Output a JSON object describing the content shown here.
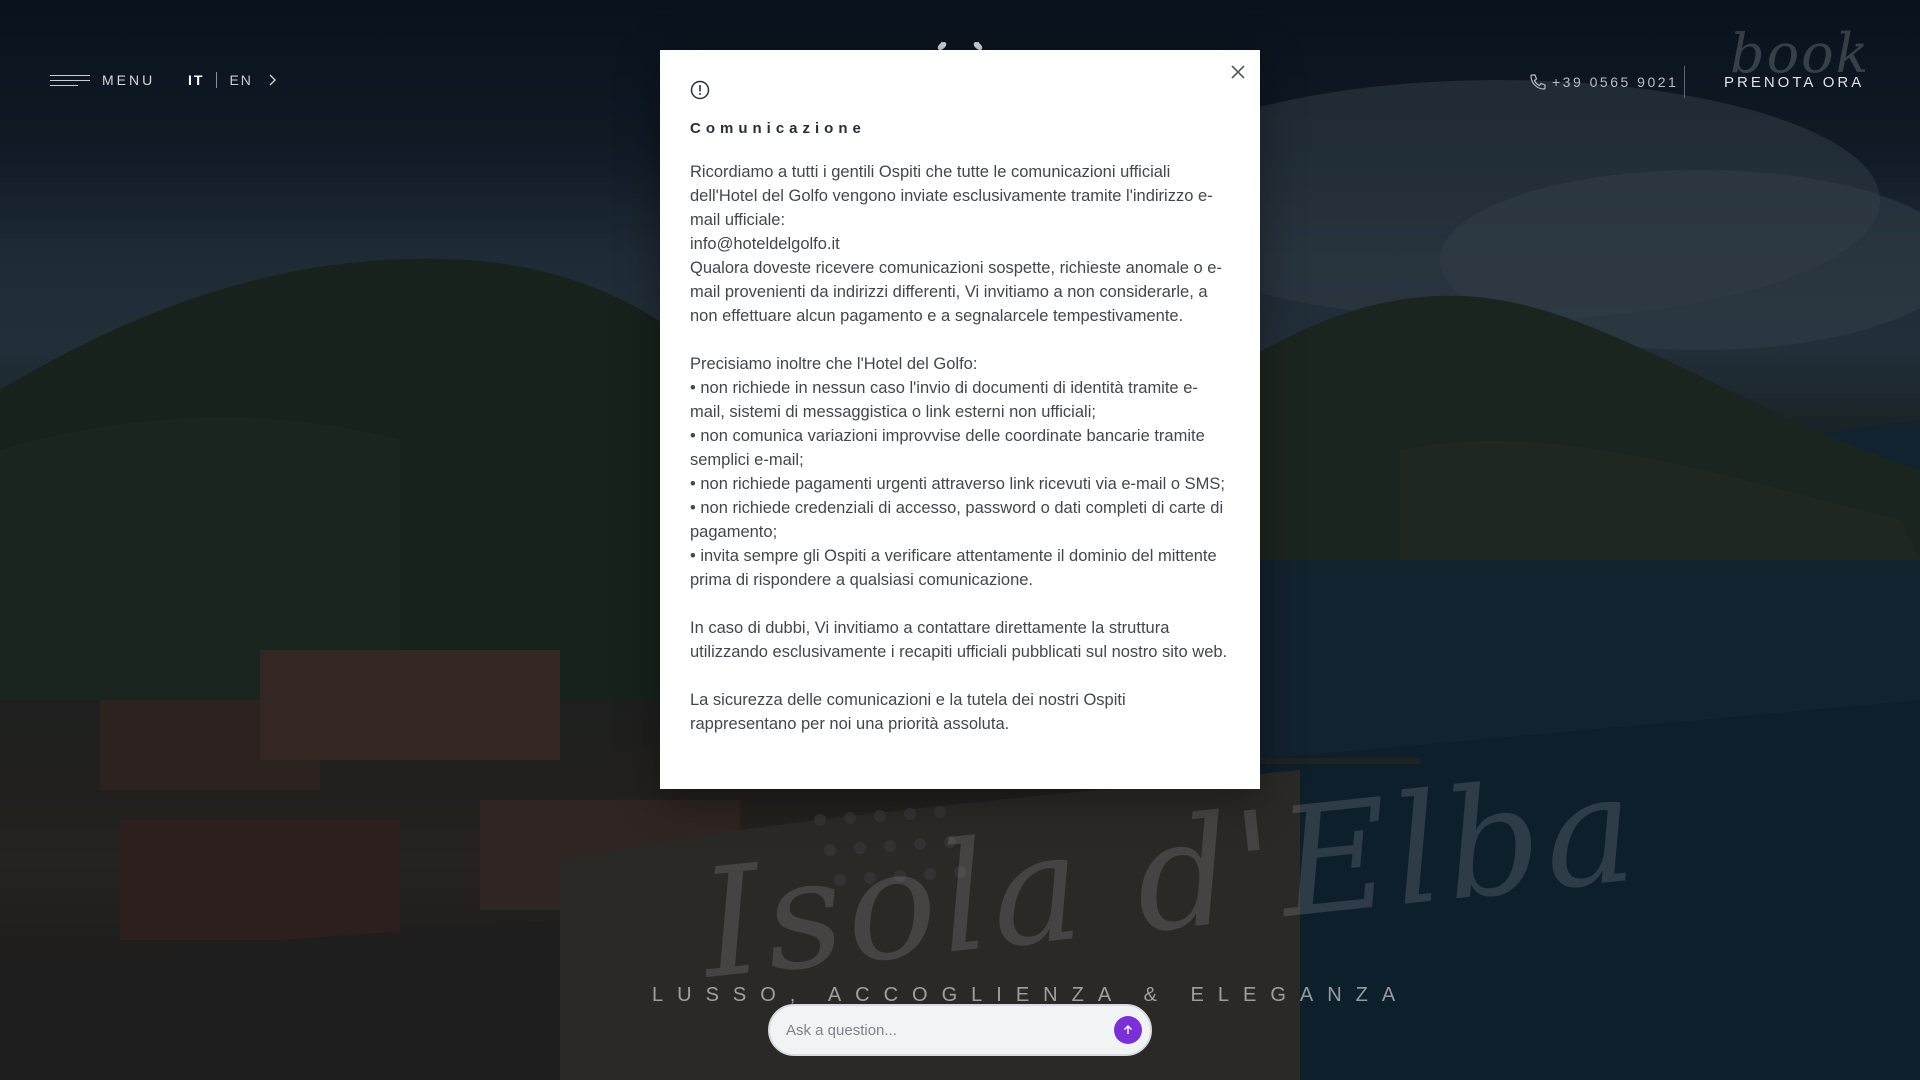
{
  "header": {
    "menu_label": "MENU",
    "lang_active": "IT",
    "lang_other": "EN",
    "phone": "+39 0565 9021",
    "book_script": "book",
    "book_button": "PRENOTA ORA"
  },
  "hero": {
    "script_text": "Isola d'Elba",
    "tagline": "LUSSO, ACCOGLIENZA & ELEGANZA"
  },
  "modal": {
    "title": "Comunicazione",
    "paragraphs": {
      "p1": "Ricordiamo a tutti i gentili Ospiti che tutte le comunicazioni ufficiali dell'Hotel del Golfo vengono inviate esclusivamente tramite l'indirizzo e-mail ufficiale:",
      "email": "info@hoteldelgolfo.it",
      "p2": "Qualora doveste ricevere comunicazioni sospette, richieste anomale o e-mail provenienti da indirizzi differenti, Vi invitiamo a non considerarle, a non effettuare alcun pagamento e a segnalarcele tempestivamente.",
      "p3": "Precisiamo inoltre che l'Hotel del Golfo:",
      "b1": "• non richiede in nessun caso l'invio di documenti di identità tramite e-mail, sistemi di messaggistica o link esterni non ufficiali;",
      "b2": "• non comunica variazioni improvvise delle coordinate bancarie tramite semplici e-mail;",
      "b3": "• non richiede pagamenti urgenti attraverso link ricevuti via e-mail o SMS;",
      "b4": "• non richiede credenziali di accesso, password o dati completi di carte di pagamento;",
      "b5": "• invita sempre gli Ospiti a verificare attentamente il dominio del mittente prima di rispondere a qualsiasi comunicazione.",
      "p4": "In caso di dubbi, Vi invitiamo a contattare direttamente la struttura utilizzando esclusivamente i recapiti ufficiali pubblicati sul nostro sito web.",
      "p5": "La sicurezza delle comunicazioni e la tutela dei nostri Ospiti rappresentano per noi una priorità assoluta."
    }
  },
  "ask": {
    "placeholder": "Ask a question..."
  },
  "colors": {
    "send_button": "#7b2fd6",
    "modal_bg": "#ffffff",
    "overlay": "#080e16"
  },
  "icons": {
    "menu": "hamburger-icon",
    "lang_next": "chevron-right-icon",
    "phone": "phone-icon",
    "crest": "laurel-crest-icon",
    "close": "close-icon",
    "alert": "alert-circle-icon",
    "send": "arrow-up-icon"
  }
}
